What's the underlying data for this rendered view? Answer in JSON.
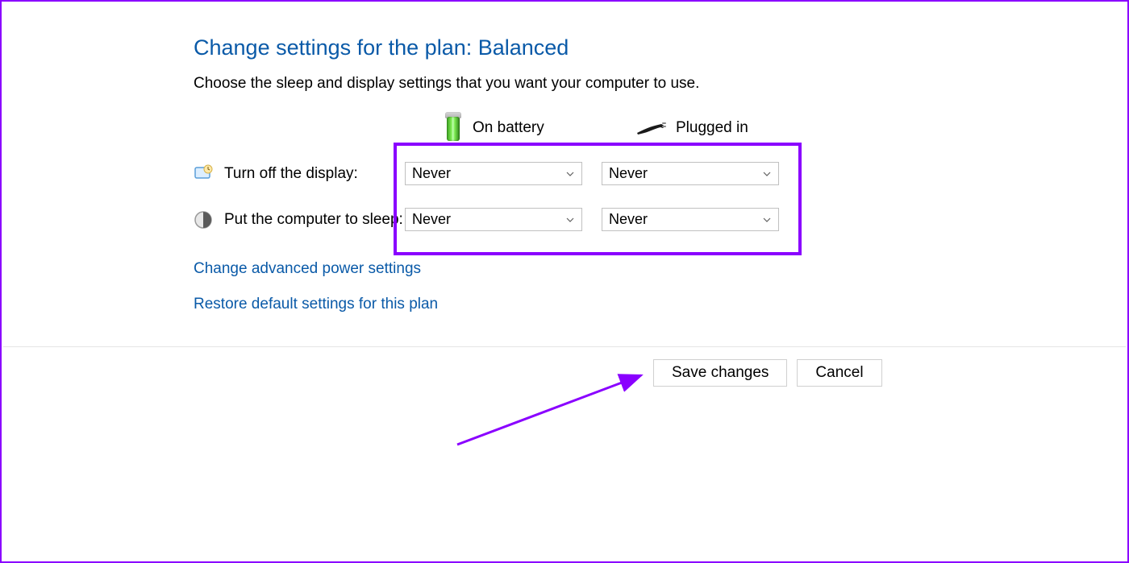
{
  "title": "Change settings for the plan: Balanced",
  "instruction": "Choose the sleep and display settings that you want your computer to use.",
  "columns": {
    "battery": "On battery",
    "plugged": "Plugged in"
  },
  "rows": {
    "display": {
      "label": "Turn off the display:",
      "battery_value": "Never",
      "plugged_value": "Never"
    },
    "sleep": {
      "label": "Put the computer to sleep:",
      "battery_value": "Never",
      "plugged_value": "Never"
    }
  },
  "links": {
    "advanced": "Change advanced power settings",
    "restore": "Restore default settings for this plan"
  },
  "buttons": {
    "save": "Save changes",
    "cancel": "Cancel"
  }
}
